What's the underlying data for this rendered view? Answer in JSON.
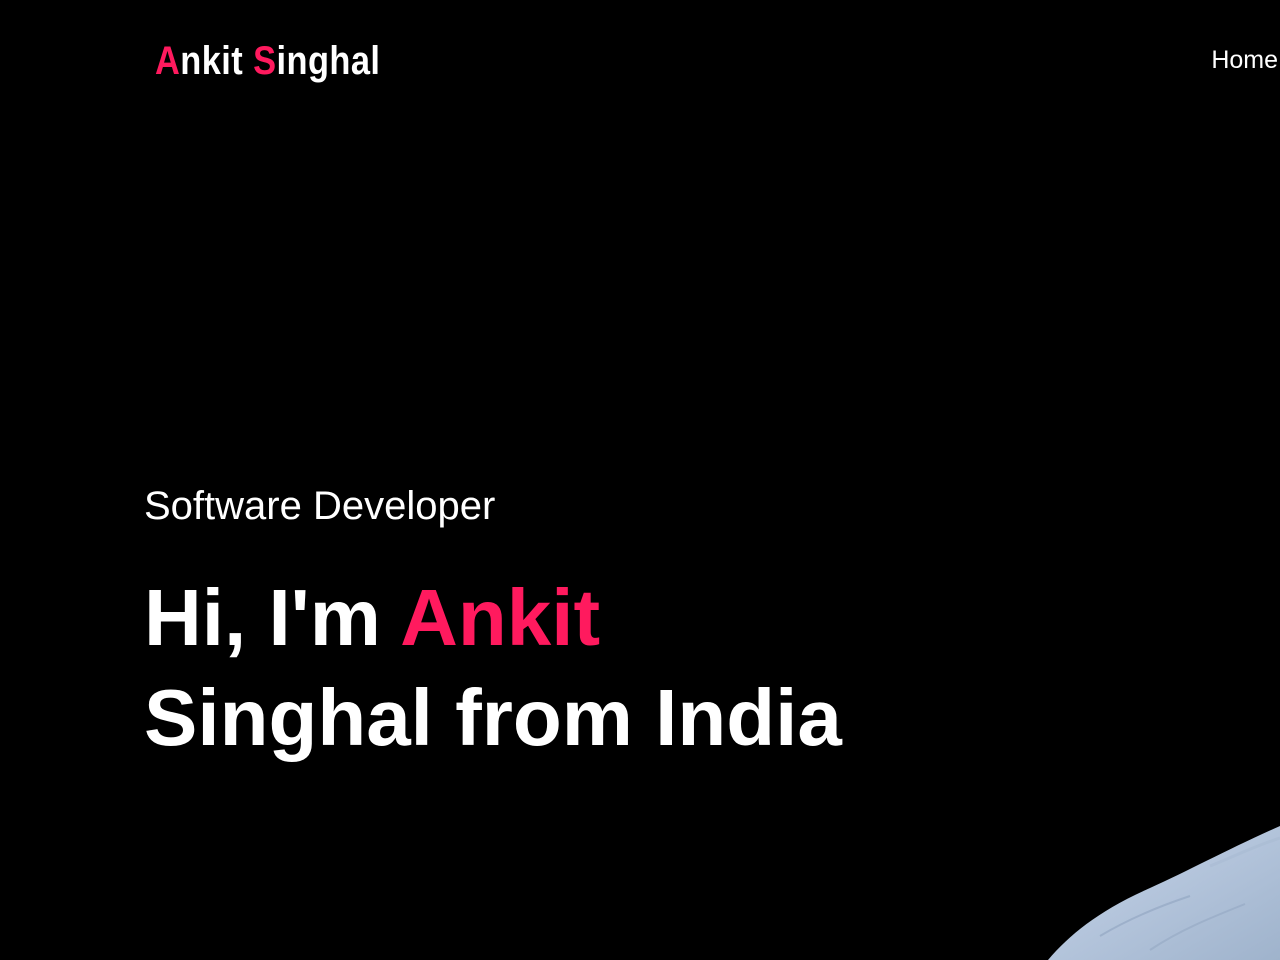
{
  "header": {
    "logo": {
      "first_initial": "A",
      "first_rest": "nkit ",
      "last_initial": "S",
      "last_rest": "inghal"
    },
    "nav": {
      "items": [
        {
          "label": "Home"
        }
      ]
    }
  },
  "hero": {
    "subtitle": "Software Developer",
    "title": {
      "line1_prefix": "Hi, I'm ",
      "line1_highlight": "Ankit",
      "line2": "Singhal from India"
    }
  },
  "colors": {
    "background": "#000000",
    "accent": "#ff1a5e",
    "text": "#ffffff",
    "shirt": "#b7c8de"
  }
}
